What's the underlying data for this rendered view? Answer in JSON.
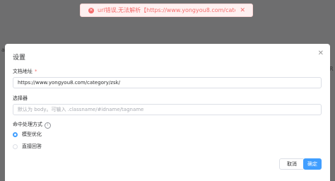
{
  "toast": {
    "message": "url错误,无法解析【https://www.yongyou8.com/category/zsk/】",
    "icon": "error-circle-icon",
    "close_icon": "close-icon"
  },
  "background": {
    "left_fragment": "av",
    "right_fragment": "R"
  },
  "dialog": {
    "title": "设置",
    "close_icon": "close-icon",
    "doc_address_label": "文档地址",
    "required_mark": "*",
    "doc_address_value": "https://www.yongyou8.com/category/zsk/",
    "selector_label": "选择器",
    "selector_placeholder": "默认为 body。可输入 .classname/#idname/tagname",
    "hit_mode_label": "命中处理方式",
    "hit_mode_icon": "info-icon",
    "radio_options": [
      {
        "label": "模型优化",
        "checked": true
      },
      {
        "label": "直接回答",
        "checked": false
      }
    ],
    "cancel_label": "取消",
    "confirm_label": "确定"
  },
  "colors": {
    "primary": "#409eff",
    "error": "#f56c6c",
    "overlay": "rgba(0,0,0,0.55)"
  }
}
